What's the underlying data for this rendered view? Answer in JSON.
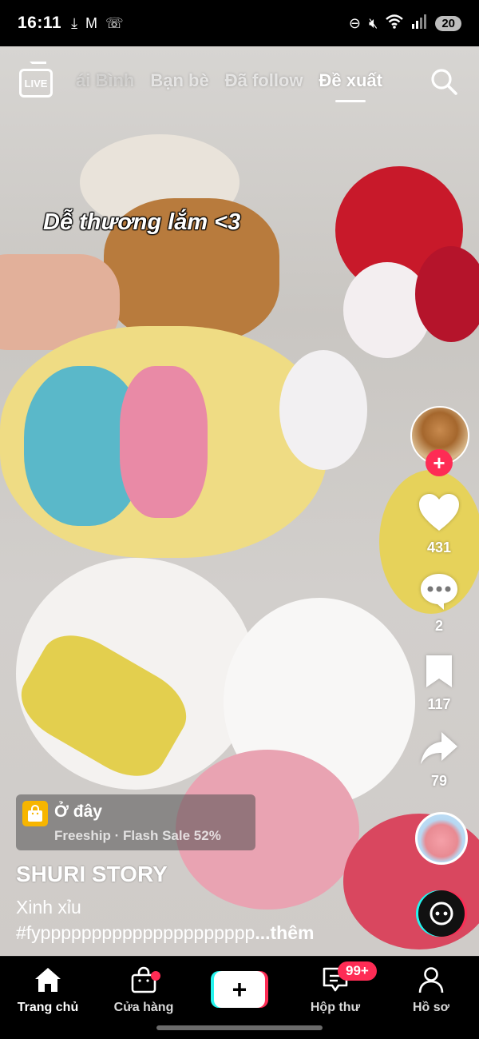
{
  "status_bar": {
    "time": "16:11",
    "left_icons": [
      "download-icon",
      "gmail-icon",
      "missed-call-icon"
    ],
    "right_icons": [
      "do-not-disturb-icon",
      "mute-icon",
      "wifi-icon",
      "signal-icon"
    ],
    "battery": "20"
  },
  "top_nav": {
    "live_label": "LIVE",
    "tabs": [
      {
        "label": "ái Bình",
        "state": "faded"
      },
      {
        "label": "Bạn bè",
        "state": "inactive"
      },
      {
        "label": "Đã follow",
        "state": "inactive"
      },
      {
        "label": "Đề xuất",
        "state": "active"
      }
    ]
  },
  "video": {
    "overlay_text": "Dễ thương lắm <3"
  },
  "right_rail": {
    "likes": "431",
    "comments": "2",
    "saves": "117",
    "shares": "79",
    "follow_symbol": "+"
  },
  "shop_chip": {
    "title": "Ở đây",
    "subtitle": "Freeship · Flash Sale 52%"
  },
  "author": "SHURI STORY",
  "description": {
    "line1": "Xinh xỉu",
    "line2": "#fyppppppppppppppppppppp",
    "more": "...thêm"
  },
  "bottom_nav": {
    "home": "Trang chủ",
    "shop": "Cửa hàng",
    "create": "+",
    "inbox": "Hộp thư",
    "inbox_badge": "99+",
    "profile": "Hồ sơ"
  },
  "colors": {
    "accent_red": "#fe2c55",
    "accent_cyan": "#25f4ee",
    "shop_yellow": "#f7b500"
  }
}
